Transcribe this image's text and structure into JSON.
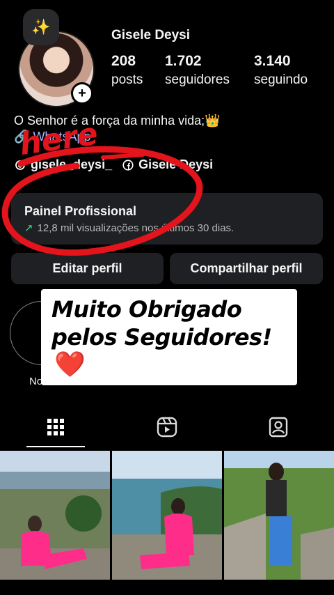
{
  "profile": {
    "note_icon": "sparkles-icon",
    "username": "Gisele Deysi",
    "stats": [
      {
        "value": "208",
        "label": "posts"
      },
      {
        "value": "1.702",
        "label": "seguidores"
      },
      {
        "value": "3.140",
        "label": "seguindo"
      }
    ],
    "bio_line": "O Senhor é a força da minha vida;👑",
    "bio_link": "WhatsApp",
    "threads_handle": "gisele_deysi_",
    "threads_name": "Gisele Deysi"
  },
  "dashboard": {
    "title": "Painel Profissional",
    "subtitle": "12,8 mil visualizações nos últimos 30 dias."
  },
  "buttons": {
    "edit": "Editar perfil",
    "share": "Compartilhar perfil"
  },
  "highlights": {
    "new_label": "Novo"
  },
  "overlay": {
    "line1": "Muito Obrigado",
    "line2": "pelos Seguidores!",
    "heart": "❤️"
  },
  "annotation": {
    "text": "here",
    "color": "#e3141c"
  },
  "tabs": [
    {
      "name": "posts-grid",
      "icon": "grid-icon",
      "active": true
    },
    {
      "name": "reels",
      "icon": "reels-icon",
      "active": false
    },
    {
      "name": "tagged",
      "icon": "tagged-user-icon",
      "active": false
    }
  ],
  "colors": {
    "background": "#000000",
    "card": "#1f2023",
    "link": "#a5b6ff",
    "trend": "#41d38a"
  }
}
